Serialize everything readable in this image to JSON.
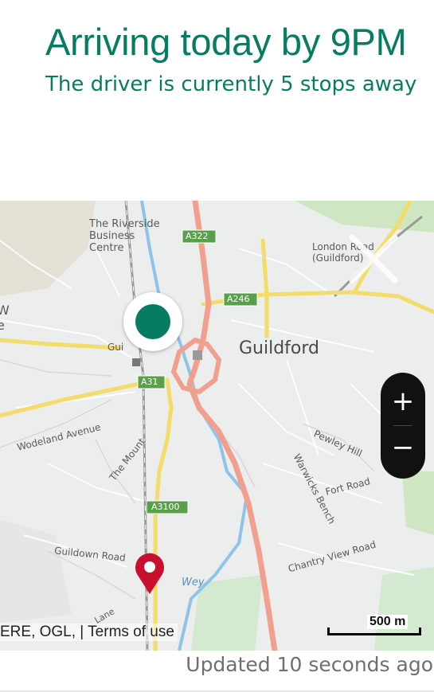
{
  "header": {
    "title": "Arriving today by 9PM",
    "subtitle": "The driver is currently 5 stops away"
  },
  "map": {
    "labels": {
      "town": "Guildford",
      "business_centre": "The Riverside Business Centre",
      "station": "London Road (Guildford)",
      "left_edge": "W e",
      "guild": "Gui",
      "road_a322": "A322",
      "road_a246": "A246",
      "road_a31": "A31",
      "road_a3100": "A3100",
      "woodland": "Wodeland Avenue",
      "the_mount": "The Mount",
      "pewley": "Pewley Hill",
      "fort": "Fort Road",
      "warwicks": "Warwicks Bench",
      "chantry": "Chantry View Road",
      "guildown": "Guildown Road",
      "wey": "Wey",
      "lane": "Lane"
    },
    "zoom_in": "+",
    "zoom_out": "−",
    "attribution": "ERE, OGL, | Terms of use",
    "scale_label": "500 m"
  },
  "status": {
    "updated": "Updated 10 seconds ago"
  },
  "colors": {
    "accent": "#067d62",
    "pin": "#c8102e",
    "main_road": "#f2a08e",
    "river": "#8ec4ea",
    "minor_road": "#f3dc69"
  },
  "icons": {
    "driver": "driver-location-icon",
    "destination": "map-pin-icon",
    "close": "close-icon"
  }
}
